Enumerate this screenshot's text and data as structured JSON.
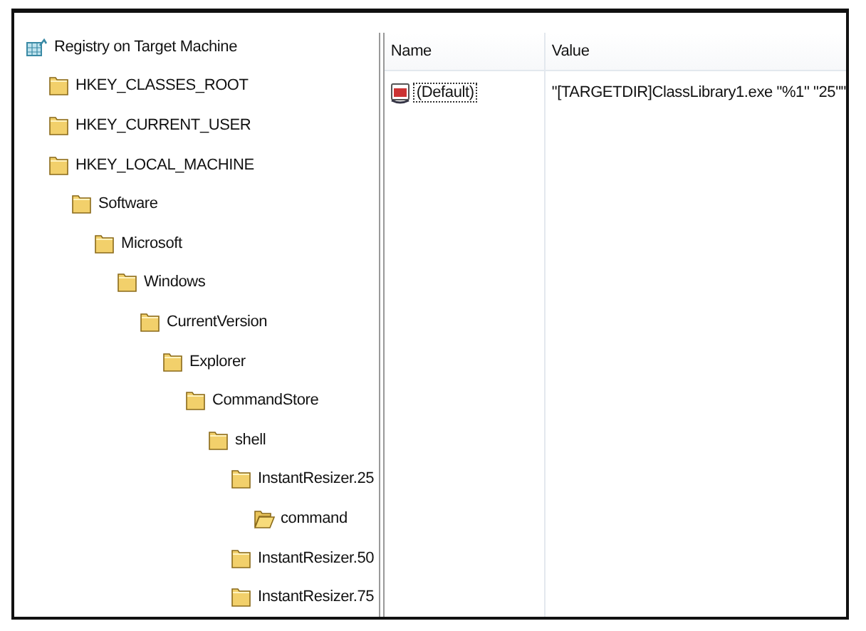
{
  "tree": {
    "label": "Registry on Target Machine",
    "children": [
      {
        "label": "HKEY_CLASSES_ROOT",
        "selected": false
      },
      {
        "label": "HKEY_CURRENT_USER",
        "selected": false
      },
      {
        "label": "HKEY_LOCAL_MACHINE",
        "selected": false,
        "children": [
          {
            "label": "Software",
            "selected": false,
            "children": [
              {
                "label": "Microsoft",
                "selected": false,
                "children": [
                  {
                    "label": "Windows",
                    "selected": false,
                    "children": [
                      {
                        "label": "CurrentVersion",
                        "selected": false,
                        "children": [
                          {
                            "label": "Explorer",
                            "selected": false,
                            "children": [
                              {
                                "label": "CommandStore",
                                "selected": false,
                                "children": [
                                  {
                                    "label": "shell",
                                    "selected": false,
                                    "children": [
                                      {
                                        "label": "InstantResizer.25",
                                        "selected": false,
                                        "children": [
                                          {
                                            "label": "command",
                                            "selected": true
                                          }
                                        ]
                                      },
                                      {
                                        "label": "InstantResizer.50",
                                        "selected": false
                                      },
                                      {
                                        "label": "InstantResizer.75",
                                        "selected": false
                                      }
                                    ]
                                  }
                                ]
                              }
                            ]
                          }
                        ]
                      }
                    ]
                  }
                ]
              }
            ]
          }
        ]
      }
    ]
  },
  "values": {
    "columns": [
      "Name",
      "Value"
    ],
    "rows": [
      {
        "name": "(Default)",
        "value": "\"[TARGETDIR]ClassLibrary1.exe \"%1\" \"25\"\"",
        "focused": true
      }
    ]
  }
}
